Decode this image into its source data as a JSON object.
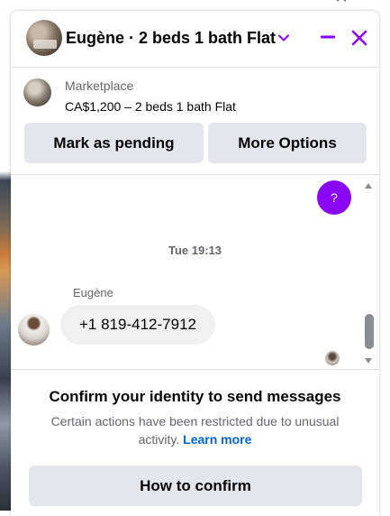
{
  "header": {
    "title": "Eugène · 2 beds 1 bath Flat",
    "icons": [
      "chevron-down-icon",
      "minimize-icon",
      "close-icon"
    ]
  },
  "marketplace": {
    "label": "Marketplace",
    "listing": "CA$1,200 – 2 beds 1 bath Flat"
  },
  "actions": {
    "mark_pending": "Mark as pending",
    "more_options": "More Options"
  },
  "messages": {
    "outgoing_symbol": "?",
    "timestamp": "Tue 19:13",
    "sender": "Eugène",
    "incoming_text": "+1 819-412-7912"
  },
  "notice": {
    "title": "Confirm your identity to send messages",
    "body": "Certain actions have been restricted due to unusual activity.",
    "link": "Learn more",
    "button": "How to confirm"
  },
  "colors": {
    "accent": "#8a05f5",
    "button_bg": "#e4e6eb",
    "link": "#0064d1",
    "secondary_text": "#65676b"
  }
}
